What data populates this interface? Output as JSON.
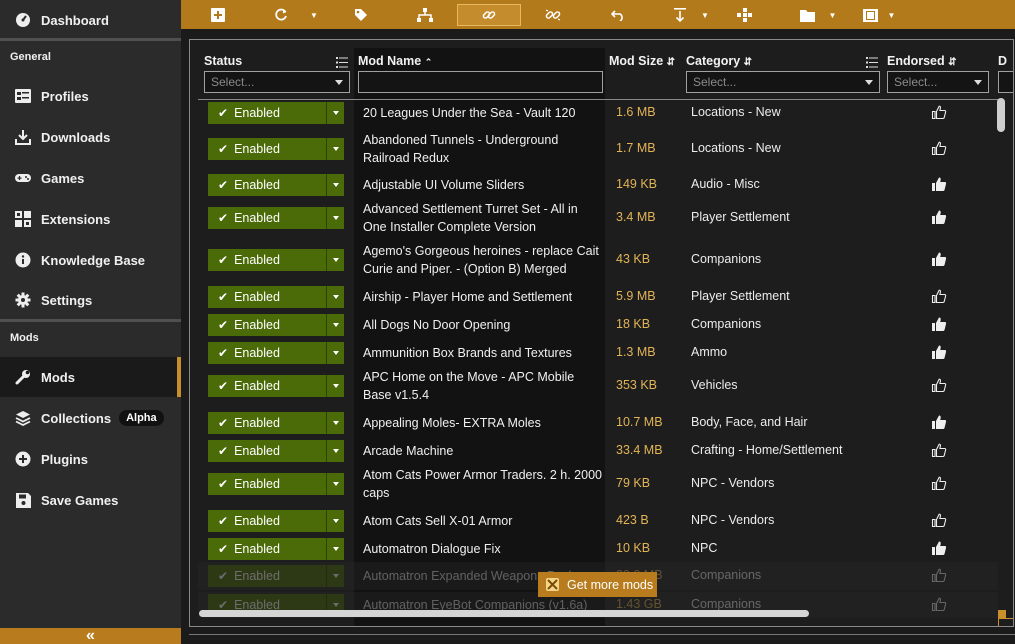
{
  "sidebar": {
    "top": [
      {
        "label": "Dashboard",
        "icon": "dashboard-icon"
      }
    ],
    "general_title": "General",
    "general": [
      {
        "label": "Profiles",
        "icon": "profiles-icon"
      },
      {
        "label": "Downloads",
        "icon": "download-icon"
      },
      {
        "label": "Games",
        "icon": "gamepad-icon"
      },
      {
        "label": "Extensions",
        "icon": "extensions-icon"
      },
      {
        "label": "Knowledge Base",
        "icon": "info-icon"
      },
      {
        "label": "Settings",
        "icon": "gear-icon"
      }
    ],
    "mods_title": "Mods",
    "mods": [
      {
        "label": "Mods",
        "icon": "wrench-icon"
      },
      {
        "label": "Collections",
        "icon": "layers-icon",
        "badge": "Alpha"
      },
      {
        "label": "Plugins",
        "icon": "plus-circle-icon"
      },
      {
        "label": "Save Games",
        "icon": "floppy-icon"
      }
    ],
    "collapse_icon": "double-chevron-left-icon"
  },
  "toolbar": {
    "buttons": [
      "add-icon",
      "refresh-icon",
      "tag-icon",
      "hierarchy-icon",
      "link-icon",
      "unlink-icon",
      "undo-icon",
      "download-arrow-icon",
      "grid-icon",
      "folder-icon",
      "film-icon"
    ]
  },
  "table": {
    "headers": {
      "status": "Status",
      "name": "Mod Name",
      "size": "Mod Size",
      "category": "Category",
      "endorsed": "Endorsed",
      "next": "D"
    },
    "filters": {
      "status_placeholder": "Select...",
      "category_placeholder": "Select...",
      "endorsed_placeholder": "Select..."
    },
    "enabled_label": "Enabled",
    "rows": [
      {
        "name": "20 Leagues Under the Sea - Vault 120",
        "size": "1.6 MB",
        "category": "Locations - New",
        "endorsed": false
      },
      {
        "name": "Abandoned Tunnels - Underground Railroad Redux",
        "size": "1.7 MB",
        "category": "Locations - New",
        "endorsed": false
      },
      {
        "name": "Adjustable UI Volume Sliders",
        "size": "149 KB",
        "category": "Audio - Misc",
        "endorsed": true
      },
      {
        "name": "Advanced Settlement Turret Set - All in One Installer Complete Version",
        "size": "3.4 MB",
        "category": "Player Settlement",
        "endorsed": true
      },
      {
        "name": "Agemo's Gorgeous heroines - replace Cait Curie and Piper. - (Option B) Merged",
        "size": "43 KB",
        "category": "Companions",
        "endorsed": true
      },
      {
        "name": "Airship - Player Home and Settlement",
        "size": "5.9 MB",
        "category": "Player Settlement",
        "endorsed": false
      },
      {
        "name": "All Dogs No Door Opening",
        "size": "18 KB",
        "category": "Companions",
        "endorsed": true
      },
      {
        "name": "Ammunition Box Brands and Textures",
        "size": "1.3 MB",
        "category": "Ammo",
        "endorsed": true
      },
      {
        "name": "APC Home on the Move - APC Mobile Base v1.5.4",
        "size": "353 KB",
        "category": "Vehicles",
        "endorsed": false
      },
      {
        "name": "Appealing Moles- EXTRA Moles",
        "size": "10.7 MB",
        "category": "Body, Face, and Hair",
        "endorsed": true
      },
      {
        "name": "Arcade Machine",
        "size": "33.4 MB",
        "category": "Crafting - Home/Settlement",
        "endorsed": false
      },
      {
        "name": "Atom Cats Power Armor Traders. 2 h. 2000 caps",
        "size": "79 KB",
        "category": "NPC - Vendors",
        "endorsed": false
      },
      {
        "name": "Atom Cats Sell X-01 Armor",
        "size": "423 B",
        "category": "NPC - Vendors",
        "endorsed": false
      },
      {
        "name": "Automatron Dialogue Fix",
        "size": "10 KB",
        "category": "NPC",
        "endorsed": true
      },
      {
        "name": "Automatron Expanded Weapons Pack",
        "size": "29.0 MB",
        "category": "Companions",
        "endorsed": false
      },
      {
        "name": "Automatron EyeBot Companions (v1.6a)",
        "size": "1.43 GB",
        "category": "Companions",
        "endorsed": false
      }
    ]
  },
  "get_more": {
    "label": "Get more mods",
    "icon": "nexus-icon"
  },
  "colors": {
    "accent": "#b37a1c",
    "enabled": "#4b6a08",
    "size_text": "#e2b455"
  }
}
